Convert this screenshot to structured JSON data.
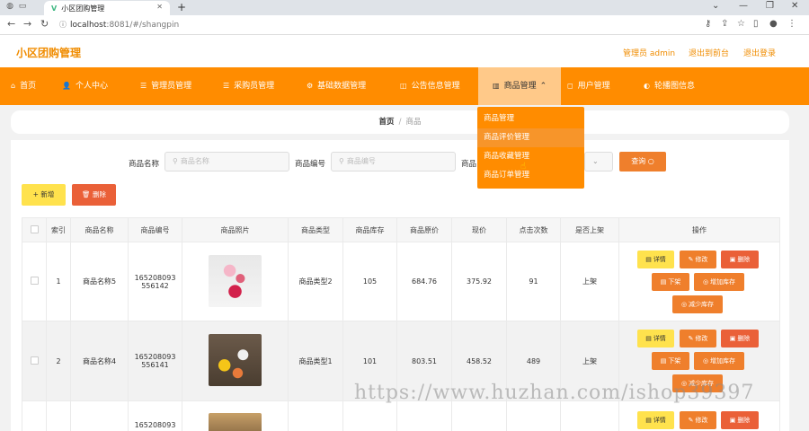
{
  "browser": {
    "tab_title": "小区团购管理",
    "url_host": "localhost",
    "url_rest": ":8081/#/shangpin"
  },
  "header": {
    "app_title": "小区团购管理",
    "admin_label": "管理员 admin",
    "back_label": "退出到前台",
    "logout_label": "退出登录"
  },
  "nav": {
    "items": [
      {
        "label": "首页",
        "icon": "home-icon"
      },
      {
        "label": "个人中心",
        "icon": "user-icon"
      },
      {
        "label": "管理员管理",
        "icon": "list-icon"
      },
      {
        "label": "采购员管理",
        "icon": "list-icon"
      },
      {
        "label": "基础数据管理",
        "icon": "gear-icon"
      },
      {
        "label": "公告信息管理",
        "icon": "bell-icon"
      },
      {
        "label": "商品管理",
        "icon": "chart-icon"
      },
      {
        "label": "用户管理",
        "icon": "users-icon"
      },
      {
        "label": "轮播图信息",
        "icon": "image-icon"
      }
    ],
    "dropdown": [
      "商品管理",
      "商品评价管理",
      "商品收藏管理",
      "商品订单管理"
    ]
  },
  "breadcrumb": {
    "home": "首页",
    "current": "商品"
  },
  "search": {
    "name_label": "商品名称",
    "name_placeholder": "商品名称",
    "code_label": "商品编号",
    "code_placeholder": "商品编号",
    "type_label": "商品",
    "query_label": "查询"
  },
  "actions": {
    "add": "新增",
    "delete": "删除"
  },
  "table": {
    "headers": [
      "索引",
      "商品名称",
      "商品编号",
      "商品照片",
      "商品类型",
      "商品库存",
      "商品原价",
      "现价",
      "点击次数",
      "是否上架",
      "操作"
    ],
    "rows": [
      {
        "index": "1",
        "name": "商品名称5",
        "code1": "165208093",
        "code2": "556142",
        "type": "商品类型2",
        "stock": "105",
        "orig": "684.76",
        "price": "375.92",
        "clicks": "91",
        "status": "上架"
      },
      {
        "index": "2",
        "name": "商品名称4",
        "code1": "165208093",
        "code2": "556141",
        "type": "商品类型1",
        "stock": "101",
        "orig": "803.51",
        "price": "458.52",
        "clicks": "489",
        "status": "上架"
      },
      {
        "index": "",
        "name": "",
        "code1": "165208093",
        "code2": "",
        "type": "",
        "stock": "",
        "orig": "",
        "price": "",
        "clicks": "",
        "status": ""
      }
    ],
    "op_labels": {
      "detail": "详情",
      "edit": "修改",
      "delete": "删除",
      "down": "下架",
      "add_stock": "增加库存",
      "reduce_stock": "减少库存"
    }
  },
  "watermark": "https://www.huzhan.com/ishop39397",
  "colors": {
    "primary": "#ff8c00",
    "nav_active": "#ffc989",
    "detail_btn": "#ffe24d",
    "op_btn": "#ef7f2c",
    "delete_btn": "#ea6038"
  }
}
